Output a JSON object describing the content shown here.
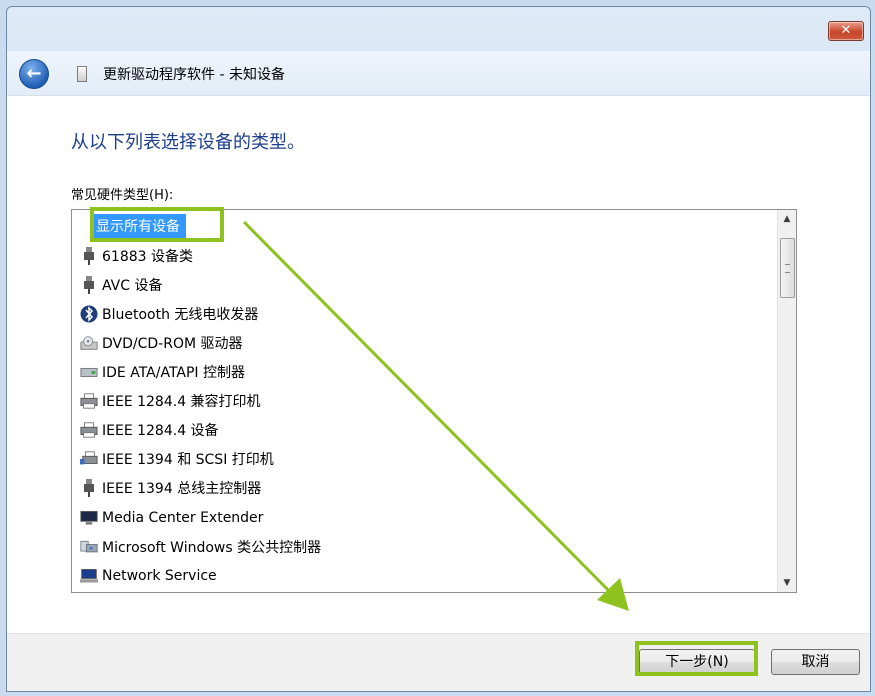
{
  "window": {
    "title": "更新驱动程序软件 - 未知设备",
    "close_glyph": "✕"
  },
  "header": {
    "back_icon": "back-arrow-icon",
    "device_icon": "device-icon"
  },
  "main": {
    "heading": "从以下列表选择设备的类型。",
    "list_label": "常见硬件类型(H):",
    "items": [
      {
        "label": "显示所有设备",
        "icon": "none",
        "selected": true
      },
      {
        "label": "61883 设备类",
        "icon": "usb-plug-icon"
      },
      {
        "label": "AVC 设备",
        "icon": "usb-plug-icon"
      },
      {
        "label": "Bluetooth 无线电收发器",
        "icon": "bluetooth-icon"
      },
      {
        "label": "DVD/CD-ROM 驱动器",
        "icon": "cdrom-drive-icon"
      },
      {
        "label": "IDE ATA/ATAPI 控制器",
        "icon": "ide-controller-icon"
      },
      {
        "label": "IEEE 1284.4 兼容打印机",
        "icon": "printer-icon"
      },
      {
        "label": "IEEE 1284.4 设备",
        "icon": "printer-icon"
      },
      {
        "label": "IEEE 1394 和 SCSI 打印机",
        "icon": "network-printer-icon"
      },
      {
        "label": "IEEE 1394 总线主控制器",
        "icon": "usb-plug-icon"
      },
      {
        "label": "Media Center Extender",
        "icon": "monitor-icon"
      },
      {
        "label": "Microsoft Windows 类公共控制器",
        "icon": "controller-icon"
      },
      {
        "label": "Network Service",
        "icon": "network-computer-icon"
      }
    ]
  },
  "footer": {
    "next_label": "下一步(N)",
    "cancel_label": "取消"
  },
  "colors": {
    "selection": "#3399ff",
    "highlight": "#8dc21f",
    "heading": "#1e3f8c"
  }
}
